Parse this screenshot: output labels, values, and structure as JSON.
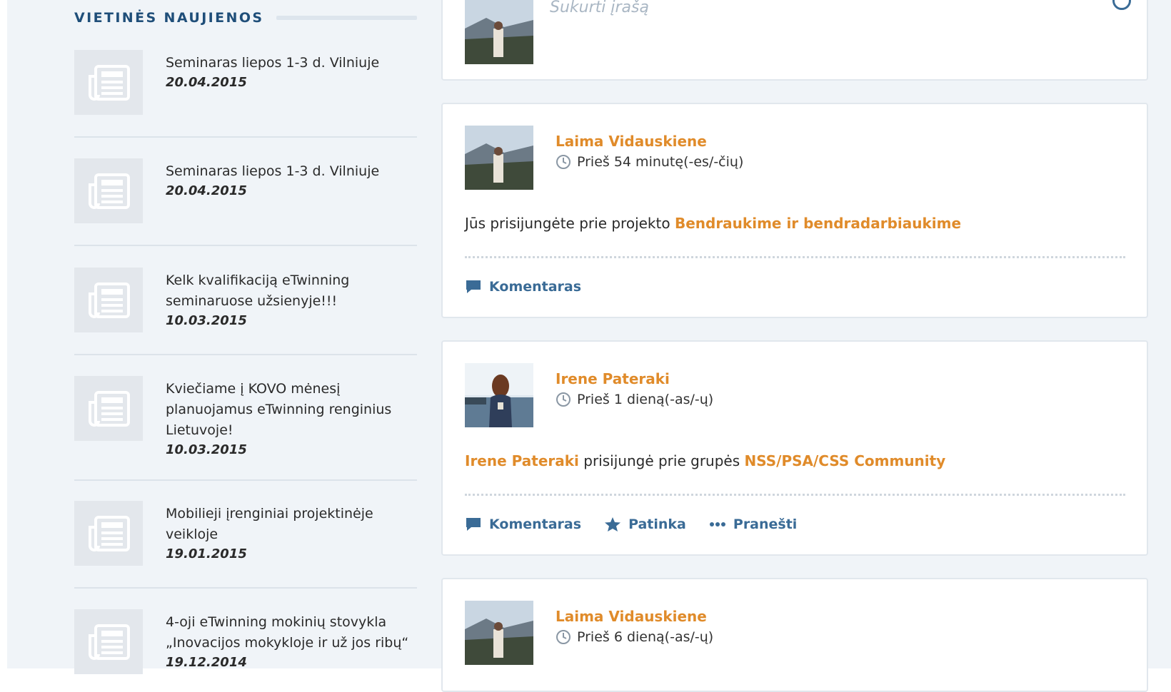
{
  "sidebar": {
    "heading": "VIETINĖS NAUJIENOS",
    "news": [
      {
        "title": "Seminaras liepos 1-3 d. Vilniuje",
        "date": "20.04.2015"
      },
      {
        "title": "Seminaras liepos 1-3 d. Vilniuje",
        "date": "20.04.2015"
      },
      {
        "title": "Kelk kvalifikaciją eTwinning seminaruose užsienyje!!!",
        "date": "10.03.2015"
      },
      {
        "title": "Kviečiame į KOVO mėnesį planuojamus eTwinning renginius Lietuvoje!",
        "date": "10.03.2015"
      },
      {
        "title": "Mobilieji įrenginiai projektinėje veikloje",
        "date": "19.01.2015"
      },
      {
        "title": "4-oji eTwinning mokinių stovykla „Inovacijos mokykloje ir už jos ribų“",
        "date": "19.12.2014"
      }
    ]
  },
  "composer": {
    "placeholder": "Sukurti įrašą"
  },
  "feed": [
    {
      "author": "Laima Vidauskiene",
      "time": "Prieš 54 minutę(-es/-čių)",
      "text_prefix": "Jūs prisijungėte prie projekto ",
      "text_link": "Bendraukime ir bendradarbiaukime",
      "actions": {
        "comment": "Komentaras"
      }
    },
    {
      "author": "Irene Pateraki",
      "time": "Prieš 1 dieną(-as/-ų)",
      "text_actor": "Irene Pateraki",
      "text_middle": " prisijungė prie grupės ",
      "text_link": "NSS/PSA/CSS Community",
      "actions": {
        "comment": "Komentaras",
        "like": "Patinka",
        "report": "Pranešti"
      }
    },
    {
      "author": "Laima Vidauskiene",
      "time": "Prieš 6 dieną(-as/-ų)"
    }
  ],
  "colors": {
    "accent": "#e08b2a",
    "heading": "#1f4e79",
    "action": "#3a6b96",
    "background": "#f0f4f8"
  }
}
